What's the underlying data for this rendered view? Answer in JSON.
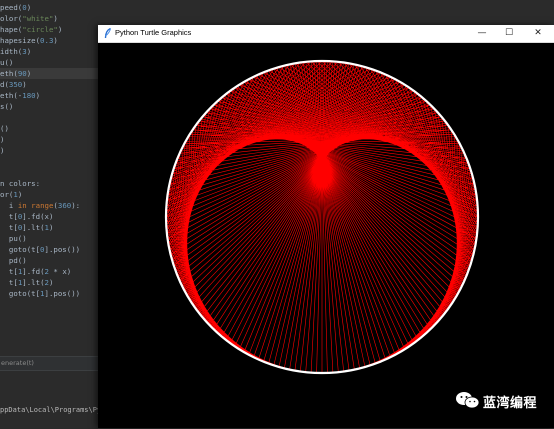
{
  "editor": {
    "code_lines": [
      "peed(0)",
      "olor(\"white\")",
      "hape(\"circle\")",
      "hapesize(0.3)",
      "idth(3)",
      "u()",
      "eth(90)",
      "d(350)",
      "eth(-180)",
      "s()",
      "",
      "()",
      ")",
      ")",
      "",
      "",
      "n colors:",
      "or(1)",
      "  i in range(360):",
      "  t[0].fd(x)",
      "  t[0].lt(1)",
      "  pu()",
      "  goto(t[0].pos())",
      "  pd()",
      "  t[1].fd(2 * x)",
      "  t[1].lt(2)",
      "  goto(t[1].pos())"
    ],
    "footer_text": "enerate(t)",
    "terminal_path": "ppData\\Local\\Programs\\Pytho"
  },
  "turtle_window": {
    "title": "Python Turtle Graphics",
    "minimize_symbol": "—",
    "maximize_symbol": "☐",
    "close_symbol": "✕"
  },
  "turtle_drawing": {
    "outer_circle_color": "#ffffff",
    "line_color": "#ff0000",
    "background": "#000000",
    "steps": 360,
    "outer_step_deg": 1,
    "inner_step_deg": 2
  },
  "watermark": {
    "text": "蓝湾编程",
    "icon": "wechat-icon"
  },
  "colors": {
    "editor_bg": "#2b2b2b",
    "code_default": "#a9b7c6",
    "code_keyword": "#cc7832",
    "code_number": "#6897bb",
    "code_string": "#6a8759"
  }
}
